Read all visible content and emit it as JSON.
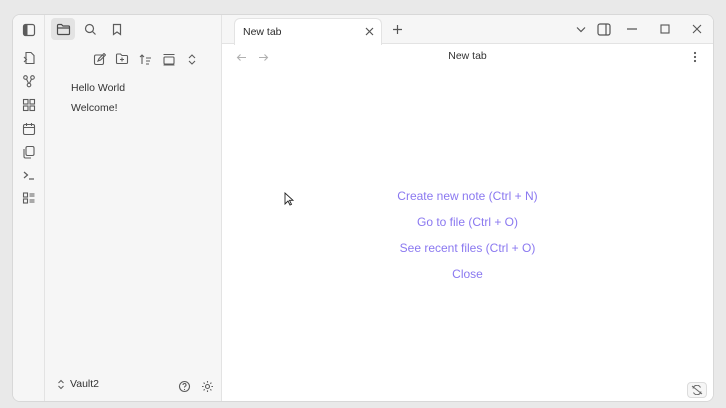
{
  "tabs": [
    {
      "title": "New tab"
    }
  ],
  "view": {
    "title": "New tab",
    "actions": [
      "Create new note (Ctrl + N)",
      "Go to file (Ctrl + O)",
      "See recent files (Ctrl + O)",
      "Close"
    ]
  },
  "files": [
    "Hello World",
    "Welcome!"
  ],
  "vault": {
    "name": "Vault2"
  },
  "colors": {
    "accent": "#8a78f0",
    "sidebar_bg": "#f6f6f6"
  },
  "icons": {
    "ribbon": [
      "sidebar-toggle-icon",
      "switcher-icon",
      "graph-icon",
      "canvas-icon",
      "calendar-icon",
      "templates-icon",
      "terminal-icon",
      "command-palette-icon"
    ],
    "sidebar_tabs": [
      "folder-icon",
      "search-icon",
      "bookmark-icon"
    ],
    "file_actions": [
      "new-note-icon",
      "new-folder-icon",
      "sort-icon",
      "collapse-icon",
      "expand-collapse-icon"
    ]
  }
}
